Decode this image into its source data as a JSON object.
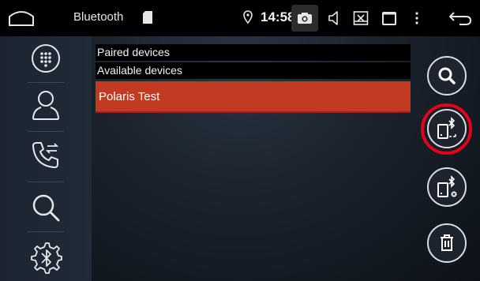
{
  "statusbar": {
    "title": "Bluetooth",
    "time": "14:58",
    "icons": [
      "home-icon",
      "sd-card-icon",
      "location-icon",
      "camera-icon",
      "volume-icon",
      "screenshot-icon",
      "window-icon",
      "more-icon",
      "back-icon"
    ]
  },
  "sidebar": {
    "items": [
      {
        "icon": "dialpad-icon"
      },
      {
        "icon": "contacts-icon"
      },
      {
        "icon": "call-log-icon"
      },
      {
        "icon": "search-icon"
      },
      {
        "icon": "bluetooth-settings-icon"
      }
    ]
  },
  "list": {
    "paired_label": "Paired devices",
    "available_label": "Available devices",
    "devices": [
      {
        "name": "Polaris Test",
        "selected": true
      }
    ]
  },
  "actions": {
    "icons": [
      "search-icon",
      "bluetooth-pair-icon",
      "bluetooth-unpair-icon",
      "trash-icon"
    ],
    "highlighted": "bluetooth-pair-icon"
  },
  "colors": {
    "selected_row": "#c23a22",
    "highlight_ring": "#e4001a",
    "statusbar_bg": "#000000"
  }
}
